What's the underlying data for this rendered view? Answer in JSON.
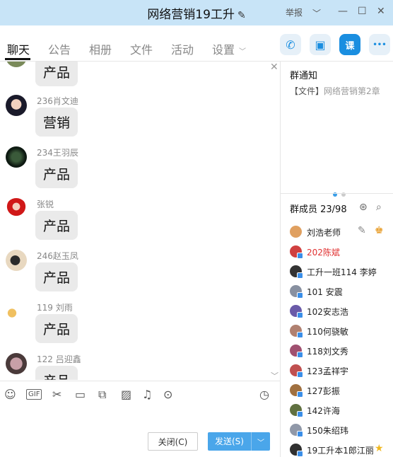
{
  "window": {
    "title": "网络营销19工升",
    "report_label": "举报"
  },
  "tabs": [
    {
      "label": "聊天"
    },
    {
      "label": "公告"
    },
    {
      "label": "相册"
    },
    {
      "label": "文件"
    },
    {
      "label": "活动"
    },
    {
      "label": "设置"
    }
  ],
  "toolbar": {
    "lesson_label": "课",
    "more_label": "•••"
  },
  "messages": [
    {
      "sender": "",
      "text": "产品"
    },
    {
      "sender": "236肖文迪",
      "text": "营销"
    },
    {
      "sender": "234王羽辰",
      "text": "产品"
    },
    {
      "sender": "张锐",
      "text": "产品"
    },
    {
      "sender": "246赵玉凤",
      "text": "产品"
    },
    {
      "sender": "119 刘雨",
      "text": "产品"
    },
    {
      "sender": "122 吕迎鑫",
      "text": "产品"
    }
  ],
  "input": {
    "gif_label": "GIF",
    "close_button": "关闭(C)",
    "send_button": "发送(S)"
  },
  "notice": {
    "title": "群通知",
    "file_tag": "【文件】",
    "file_text": "网络营销第2章"
  },
  "members": {
    "header": "群成员 23/98",
    "list": [
      {
        "name": "刘浩老师",
        "color": "#e0a060"
      },
      {
        "name": "202陈斌",
        "color": "#d04040"
      },
      {
        "name": "工升一班114 李婷",
        "color": "#333333"
      },
      {
        "name": "101 安震",
        "color": "#8890a0"
      },
      {
        "name": "102安志浩",
        "color": "#6a5aa8"
      },
      {
        "name": "110何骁敏",
        "color": "#b08070"
      },
      {
        "name": "118刘文秀",
        "color": "#a05070"
      },
      {
        "name": "123孟祥宇",
        "color": "#c05050"
      },
      {
        "name": "127彭振",
        "color": "#a07040"
      },
      {
        "name": "142许海",
        "color": "#607040"
      },
      {
        "name": "150朱绍玮",
        "color": "#9098a8"
      },
      {
        "name": "19工升本1郎江丽",
        "color": "#303030"
      }
    ]
  }
}
